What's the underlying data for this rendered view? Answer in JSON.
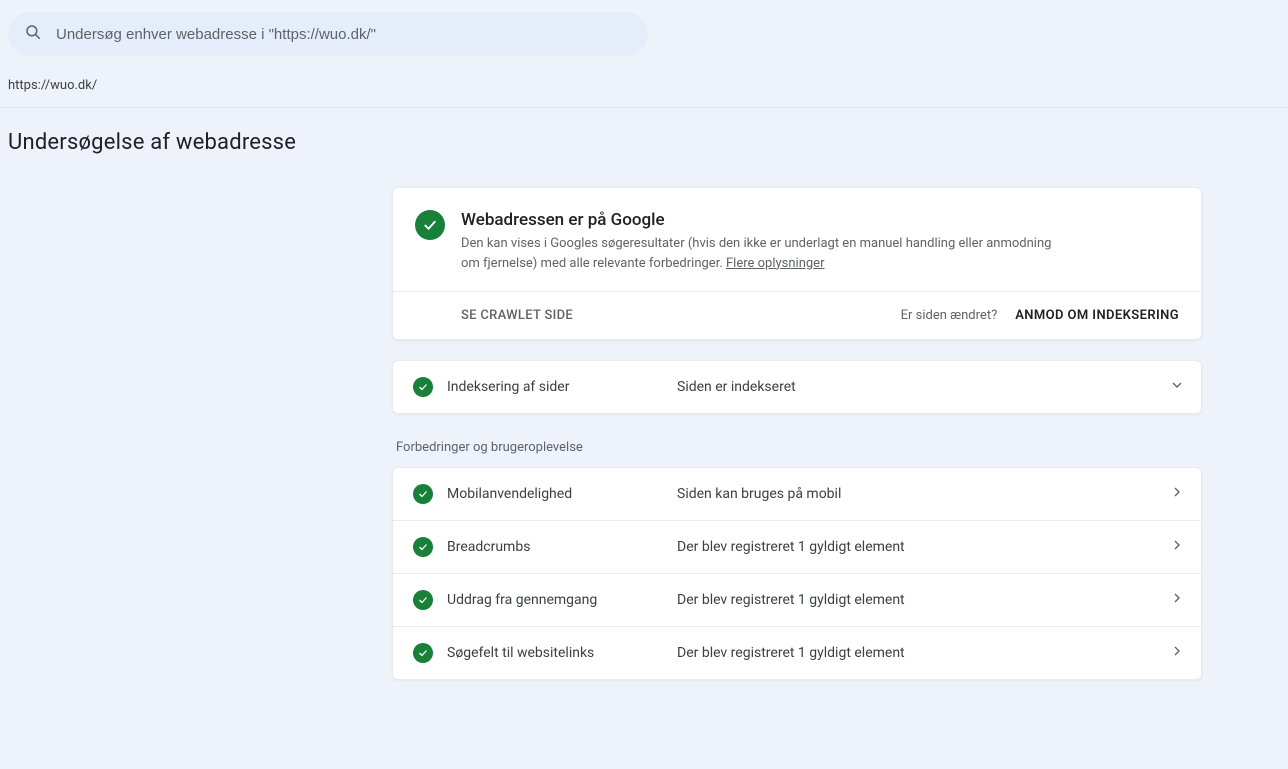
{
  "search": {
    "placeholder": "Undersøg enhver webadresse i \"https://wuo.dk/\""
  },
  "inspected_url": "https://wuo.dk/",
  "page_title": "Undersøgelse af webadresse",
  "main_card": {
    "title": "Webadressen er på Google",
    "description_prefix": "Den kan vises i Googles søgeresultater (hvis den ikke er underlagt en manuel handling eller anmodning om fjernelse) med alle relevante forbedringer. ",
    "more_link": "Flere oplysninger",
    "view_crawled": "SE CRAWLET SIDE",
    "changed_prompt": "Er siden ændret?",
    "request_indexing": "ANMOD OM INDEKSERING"
  },
  "indexing_row": {
    "label": "Indeksering af sider",
    "status": "Siden er indekseret"
  },
  "enhancements_heading": "Forbedringer og brugeroplevelse",
  "enhancements": [
    {
      "label": "Mobilanvendelighed",
      "status": "Siden kan bruges på mobil"
    },
    {
      "label": "Breadcrumbs",
      "status": "Der blev registreret 1 gyldigt element"
    },
    {
      "label": "Uddrag fra gennemgang",
      "status": "Der blev registreret 1 gyldigt element"
    },
    {
      "label": "Søgefelt til websitelinks",
      "status": "Der blev registreret 1 gyldigt element"
    }
  ],
  "colors": {
    "success": "#188038",
    "background": "#eef2fb"
  }
}
